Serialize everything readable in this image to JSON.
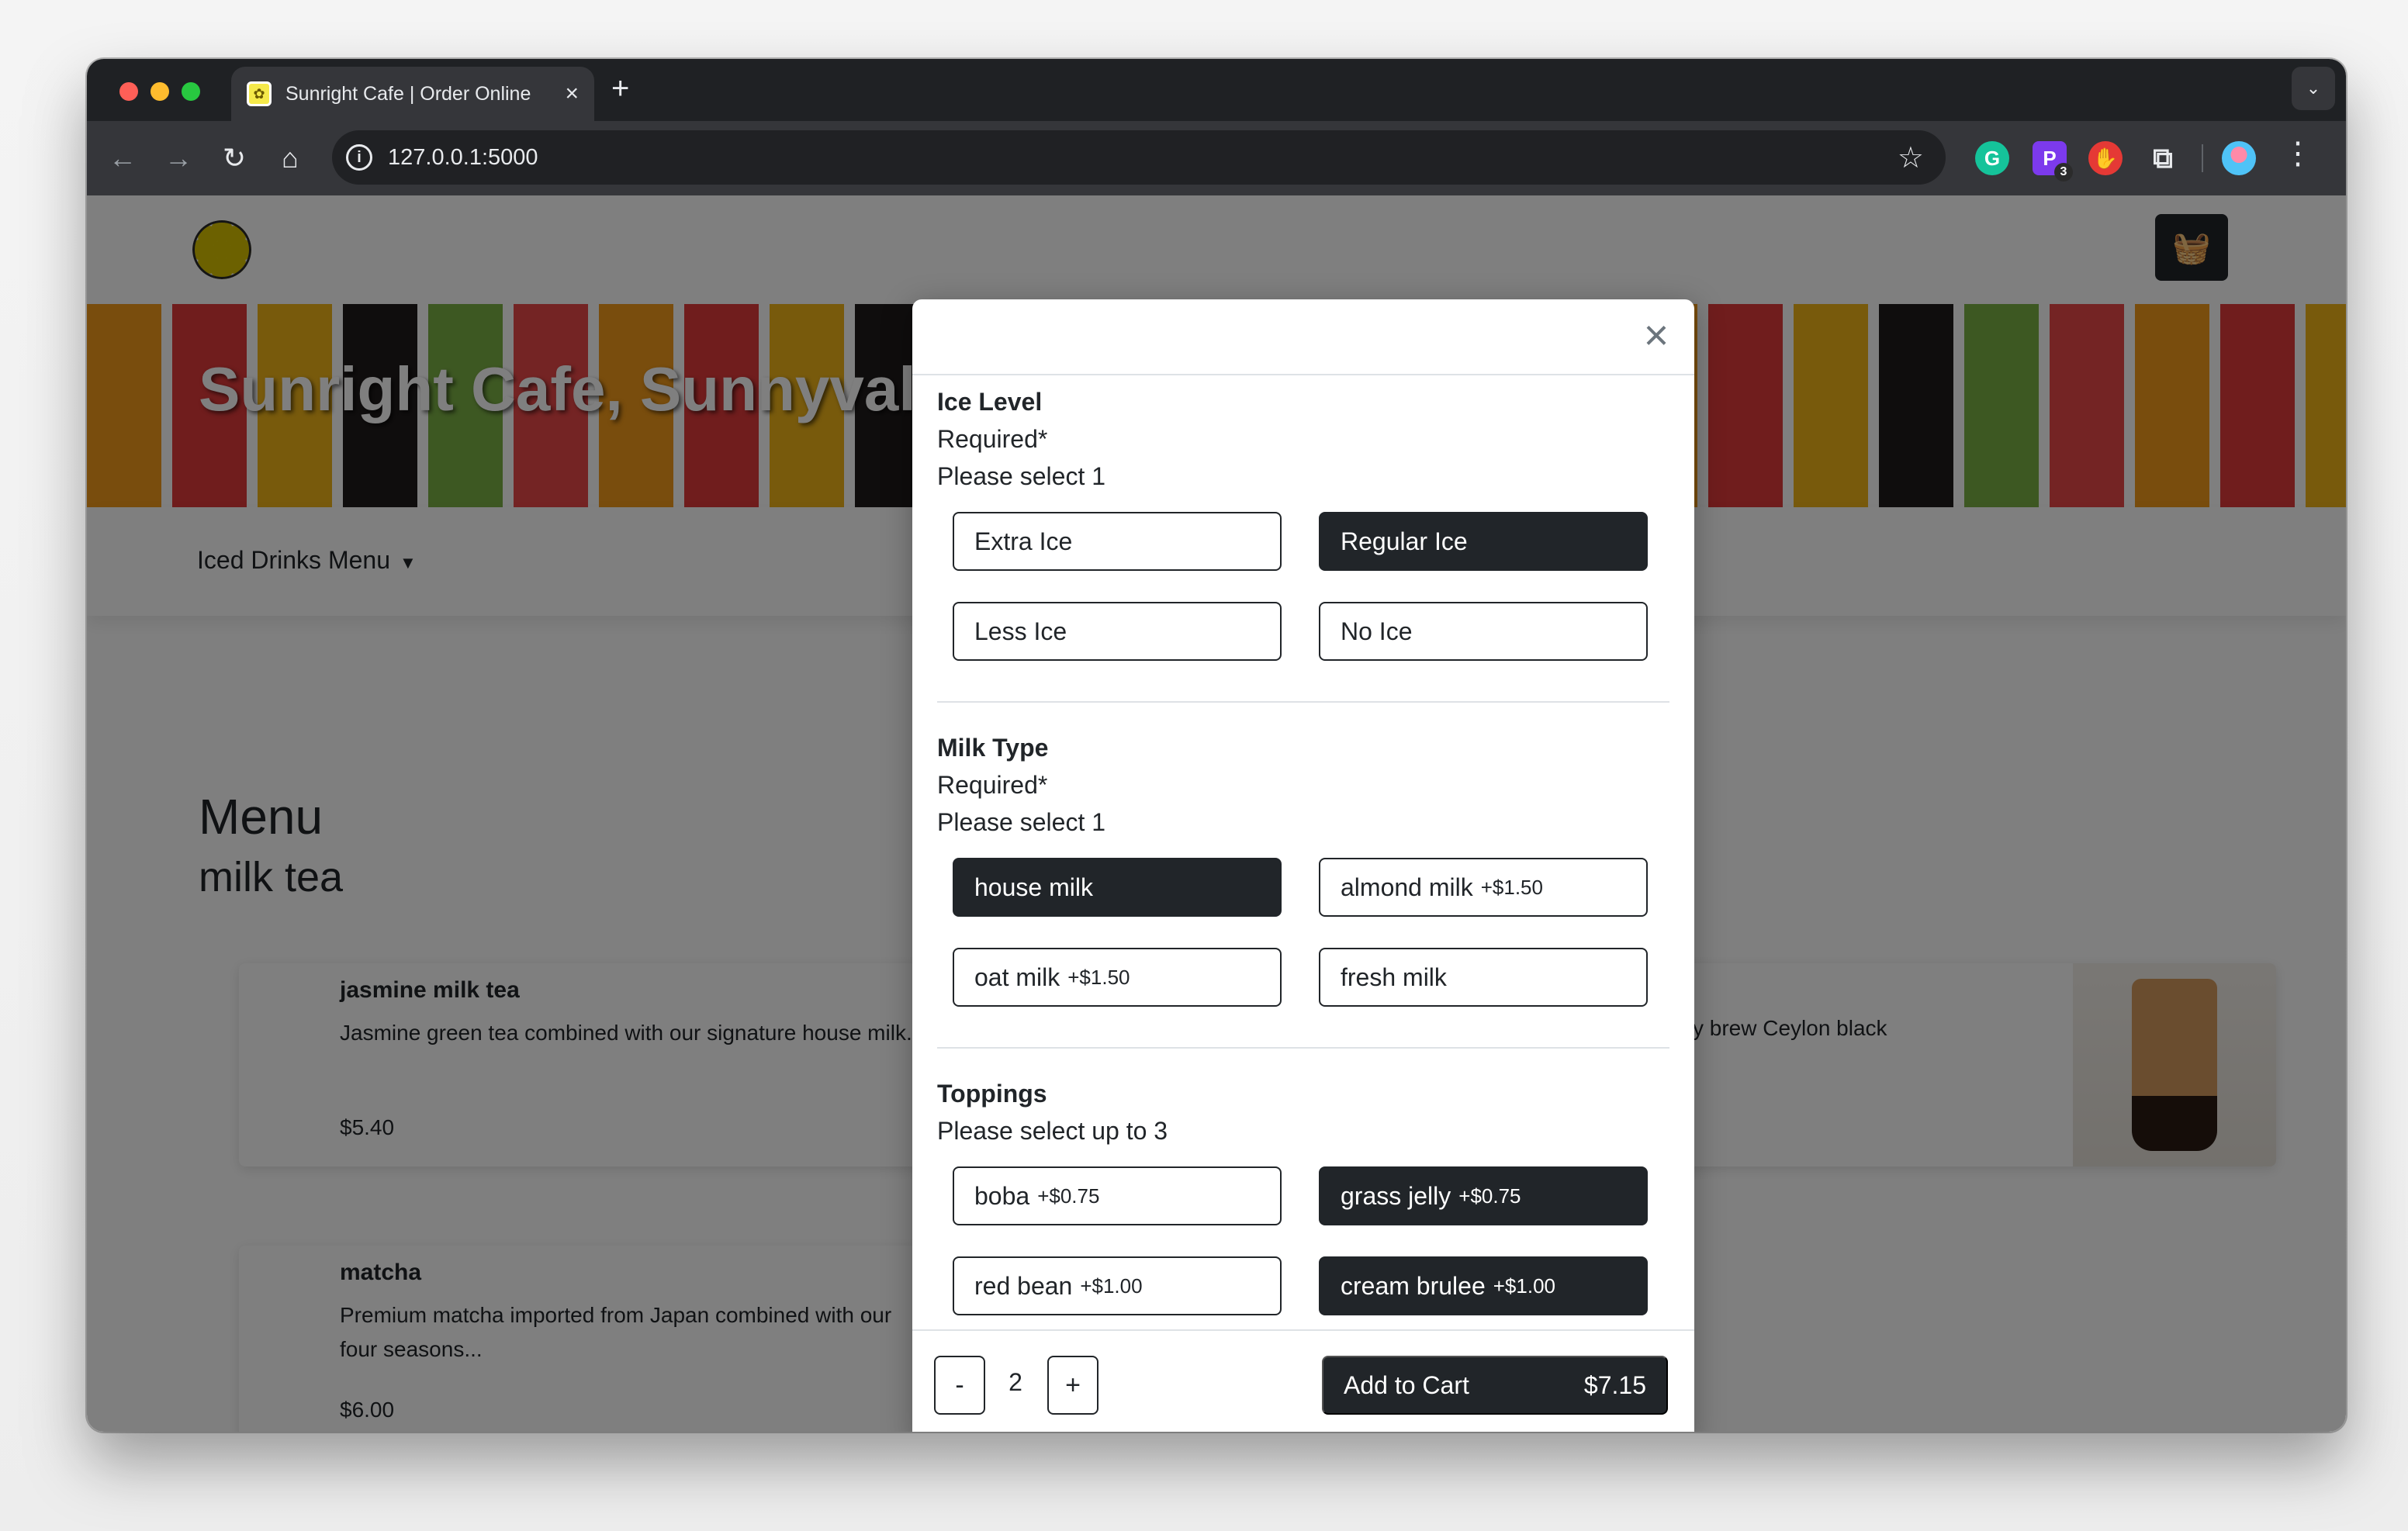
{
  "browser": {
    "tab_title": "Sunright Cafe | Order Online",
    "url": "127.0.0.1:5000",
    "extension_badge": "3"
  },
  "site": {
    "banner_title": "Sunright Cafe, Sunnyvale",
    "dropdown_label": "Iced Drinks Menu",
    "menu_heading": "Menu",
    "category_heading": "milk tea"
  },
  "cards": [
    {
      "name": "jasmine milk tea",
      "description": "Jasmine green tea combined with our signature house milk...",
      "price": "$5.40"
    },
    {
      "name": "matcha",
      "description": "Premium matcha imported from Japan combined with our four seasons...",
      "price": "$6.00"
    },
    {
      "description_fragment": "y brew Ceylon black"
    }
  ],
  "modal": {
    "ice": {
      "title": "Ice Level",
      "required": "Required*",
      "instruction": "Please select 1",
      "options": [
        {
          "label": "Extra Ice",
          "selected": false
        },
        {
          "label": "Regular Ice",
          "selected": true
        },
        {
          "label": "Less Ice",
          "selected": false
        },
        {
          "label": "No Ice",
          "selected": false
        }
      ]
    },
    "milk": {
      "title": "Milk Type",
      "required": "Required*",
      "instruction": "Please select 1",
      "options": [
        {
          "label": "house milk",
          "price": "",
          "selected": true
        },
        {
          "label": "almond milk",
          "price": "+$1.50",
          "selected": false
        },
        {
          "label": "oat milk",
          "price": "+$1.50",
          "selected": false
        },
        {
          "label": "fresh milk",
          "price": "",
          "selected": false
        }
      ]
    },
    "toppings": {
      "title": "Toppings",
      "instruction": "Please select up to 3",
      "options": [
        {
          "label": "boba",
          "price": "+$0.75",
          "selected": false
        },
        {
          "label": "grass jelly",
          "price": "+$0.75",
          "selected": true
        },
        {
          "label": "red bean",
          "price": "+$1.00",
          "selected": false
        },
        {
          "label": "cream brulee",
          "price": "+$1.00",
          "selected": true
        }
      ]
    },
    "footer": {
      "minus": "-",
      "quantity": "2",
      "plus": "+",
      "add_to_cart": "Add to Cart",
      "total": "$7.15"
    }
  }
}
